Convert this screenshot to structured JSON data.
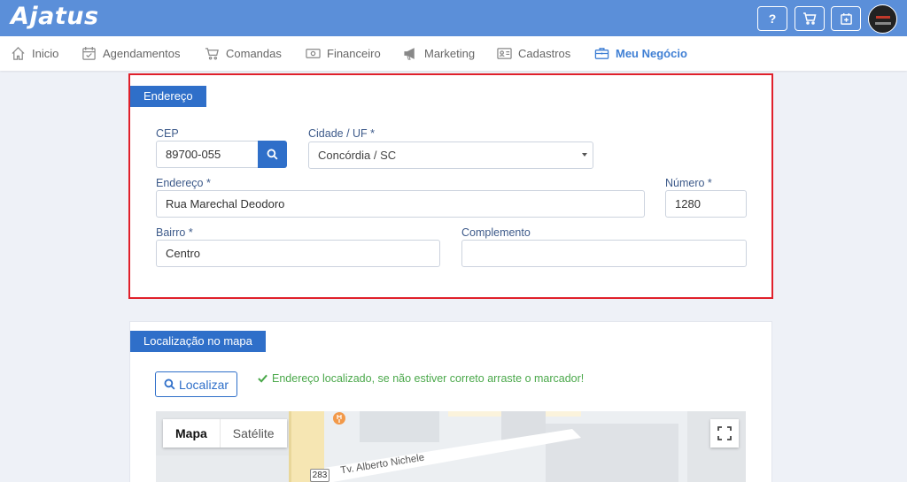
{
  "app": {
    "logo": "Ajatus"
  },
  "topbar": {
    "help_label": "?",
    "icons": [
      "help-icon",
      "cart-icon",
      "calendar-add-icon"
    ],
    "avatar_icon": "avatar-image"
  },
  "nav": {
    "items": [
      {
        "label": "Inicio",
        "icon": "home-icon"
      },
      {
        "label": "Agendamentos",
        "icon": "calendar-check-icon"
      },
      {
        "label": "Comandas",
        "icon": "cart-icon"
      },
      {
        "label": "Financeiro",
        "icon": "money-icon"
      },
      {
        "label": "Marketing",
        "icon": "megaphone-icon"
      },
      {
        "label": "Cadastros",
        "icon": "id-card-icon"
      },
      {
        "label": "Meu Negócio",
        "icon": "briefcase-icon",
        "active": true
      }
    ]
  },
  "address": {
    "tab": "Endereço",
    "cep_label": "CEP",
    "cep_value": "89700-055",
    "city_label": "Cidade / UF *",
    "city_value": "Concórdia / SC",
    "street_label": "Endereço *",
    "street_value": "Rua Marechal Deodoro",
    "number_label": "Número *",
    "number_value": "1280",
    "district_label": "Bairro *",
    "district_value": "Centro",
    "complement_label": "Complemento",
    "complement_value": ""
  },
  "location": {
    "tab": "Localização no mapa",
    "locate_label": "Localizar",
    "message": "Endereço localizado, se não estiver correto arraste o marcador!",
    "status_color": "#4aa84a"
  },
  "map": {
    "type_map": "Mapa",
    "type_satellite": "Satélite",
    "street": "Tv. Alberto Nichele",
    "route": "283"
  },
  "colors": {
    "topbar": "#5b8fd9",
    "accent": "#2f6fc9",
    "highlight_border": "#e0202b"
  }
}
